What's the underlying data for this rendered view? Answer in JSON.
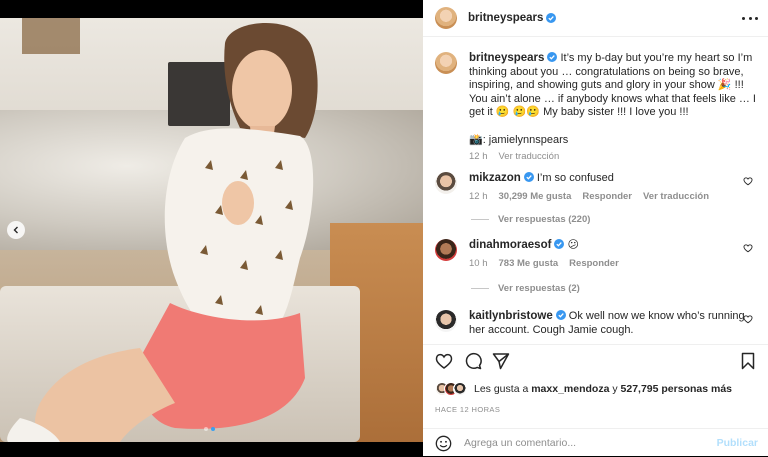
{
  "post": {
    "author": "britneyspears",
    "more_icon": "more-horizontal-icon"
  },
  "media": {
    "dots": 2,
    "active_dot": 1,
    "prev_icon": "chevron-left-icon"
  },
  "caption": {
    "username": "britneyspears",
    "text": "It’s my b-day but you’re my heart so I’m thinking about you … congratulations on being so brave, inspiring, and showing guts and glory in your show 🎉 !!! You ain’t alone … if anybody knows what that feels like … I get it 🥲 🥲🥲 My baby sister !!! I love you !!!",
    "credit": "📸: jamielynnspears",
    "time": "12 h",
    "translate": "Ver traducción"
  },
  "comments": [
    {
      "username": "mikzazon",
      "text": "I’m so confused",
      "time": "12 h",
      "likes": "30,299 Me gusta",
      "reply": "Responder",
      "translate": "Ver traducción",
      "replies": "Ver respuestas (220)"
    },
    {
      "username": "dinahmoraesof",
      "text": "😕",
      "time": "10 h",
      "likes": "783 Me gusta",
      "reply": "Responder",
      "replies": "Ver respuestas (2)"
    },
    {
      "username": "kaitlynbristowe",
      "text": "Ok well now we know who’s running her account. Cough Jamie cough."
    }
  ],
  "actions": {
    "liked_by_prefix": "Les gusta a",
    "liked_by_user": "maxx_mendoza",
    "liked_by_mid": "y",
    "liked_by_count": "527,795 personas más",
    "time_ago": "HACE 12 HORAS"
  },
  "composer": {
    "placeholder": "Agrega un comentario...",
    "publish": "Publicar"
  },
  "colors": {
    "verified": "#3897f0",
    "publish_disabled": "#b2dffc",
    "secondary_text": "#8e8e8e"
  }
}
